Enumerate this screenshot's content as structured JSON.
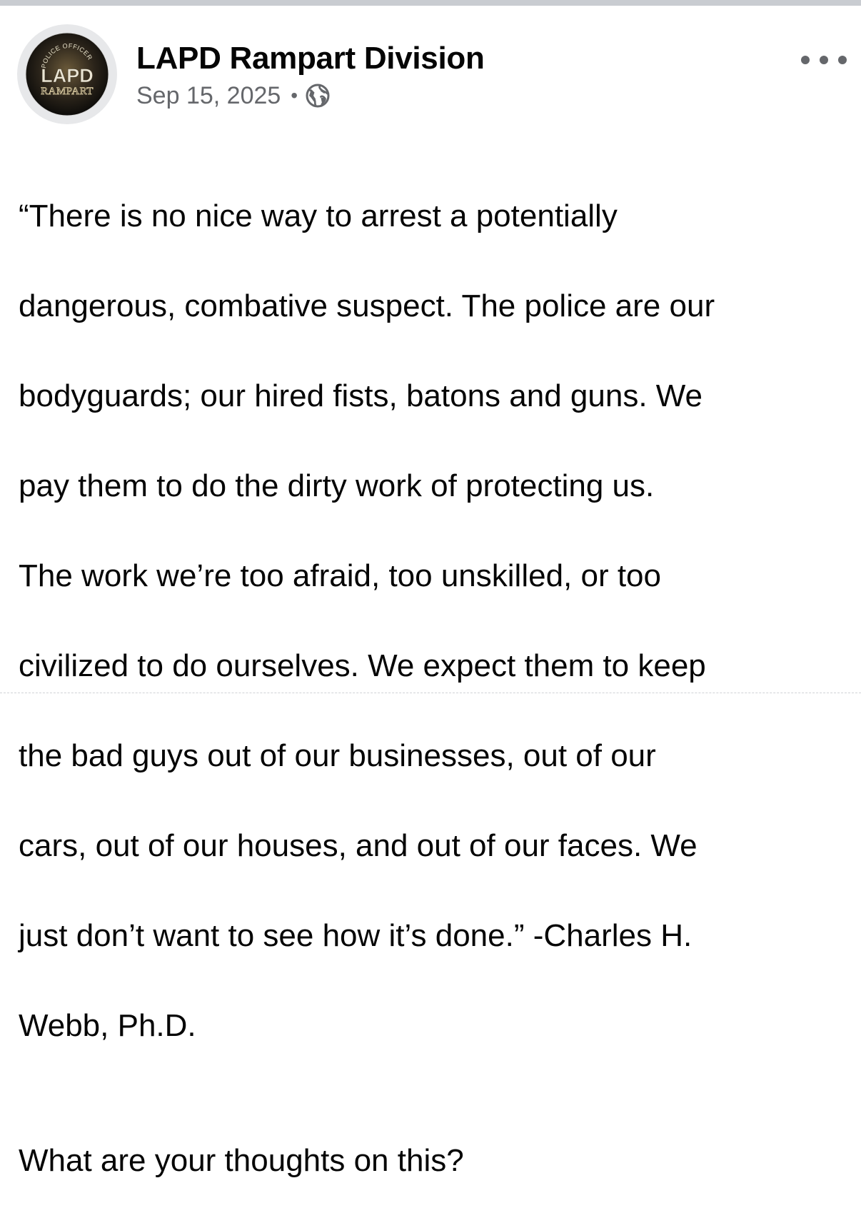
{
  "post": {
    "author": {
      "name": "LAPD Rampart Division",
      "avatar_icon": "lapd-rampart-badge-icon",
      "avatar_text": {
        "top": "POLICE OFFICER",
        "main": "LAPD",
        "bottom": "RAMPART"
      }
    },
    "date": "Sep 15, 2025",
    "separator": "•",
    "audience_icon": "globe-icon",
    "more_icon": "more-options-icon",
    "body_lines": [
      "“There is no nice way to arrest a potentially",
      "dangerous, combative suspect. The police are our",
      "bodyguards; our hired fists, batons and guns. We",
      "pay them to do the dirty work of protecting us.",
      "The work we’re too afraid, too unskilled, or too",
      "civilized to do ourselves. We expect them to keep",
      "the bad guys out of our businesses, out of our",
      "cars, out of our houses, and out of our faces. We",
      "just don’t want to see how it’s done.”  -Charles H.",
      "Webb, Ph.D."
    ],
    "question": "What are your thoughts on this?"
  },
  "colors": {
    "text_primary": "#050505",
    "text_secondary": "#65676b",
    "top_bar": "#c9ccd1"
  }
}
